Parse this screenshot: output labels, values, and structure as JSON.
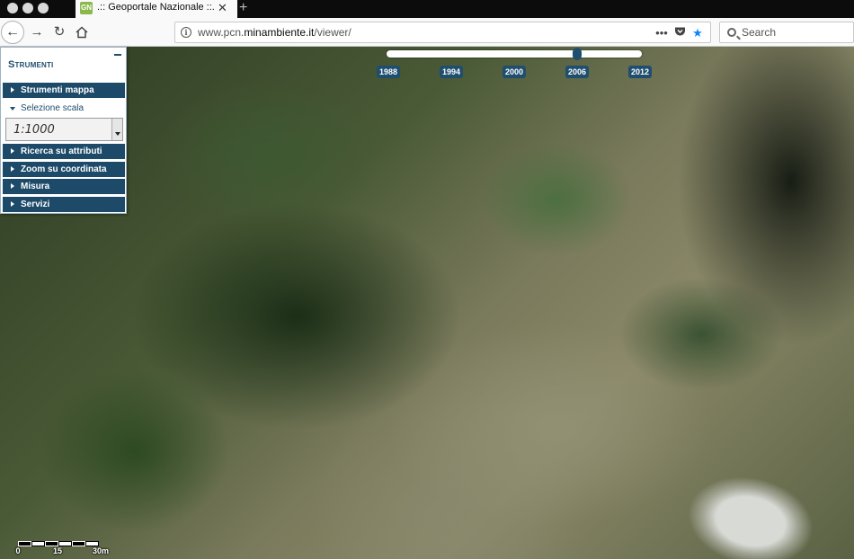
{
  "browser": {
    "tab": {
      "favicon_text": "GN",
      "title": ".:: Geoportale Nazionale ::.",
      "close_glyph": "✕"
    },
    "new_tab_glyph": "+",
    "url": {
      "prefix": "www.pcn.",
      "domain": "minambiente.it",
      "path": "/viewer/"
    },
    "search": {
      "placeholder": "Search"
    },
    "icons": [
      "back-arrow-icon",
      "forward-arrow-icon",
      "reload-icon",
      "home-icon",
      "info-icon",
      "more-dots-icon",
      "pocket-icon",
      "bookmark-star-icon",
      "search-icon"
    ]
  },
  "timeline": {
    "years": [
      "1988",
      "1994",
      "2000",
      "2006",
      "2012"
    ],
    "selected": "2006",
    "handle_fraction": 0.75
  },
  "tools_panel": {
    "title": "Strumenti",
    "collapse_glyph": "−",
    "items": [
      {
        "label": "Strumenti mappa"
      },
      {
        "label": "Selezione scala",
        "expanded": true
      },
      {
        "label": "Ricerca su attributi"
      },
      {
        "label": "Zoom su coordinata"
      },
      {
        "label": "Misura"
      },
      {
        "label": "Servizi"
      }
    ],
    "scale": {
      "value": "1:1000"
    }
  },
  "scalebar": {
    "labels": [
      "0",
      "15",
      "30m"
    ]
  },
  "colors": {
    "panel_accent": "#1c4a68",
    "star": "#0a84ff"
  }
}
